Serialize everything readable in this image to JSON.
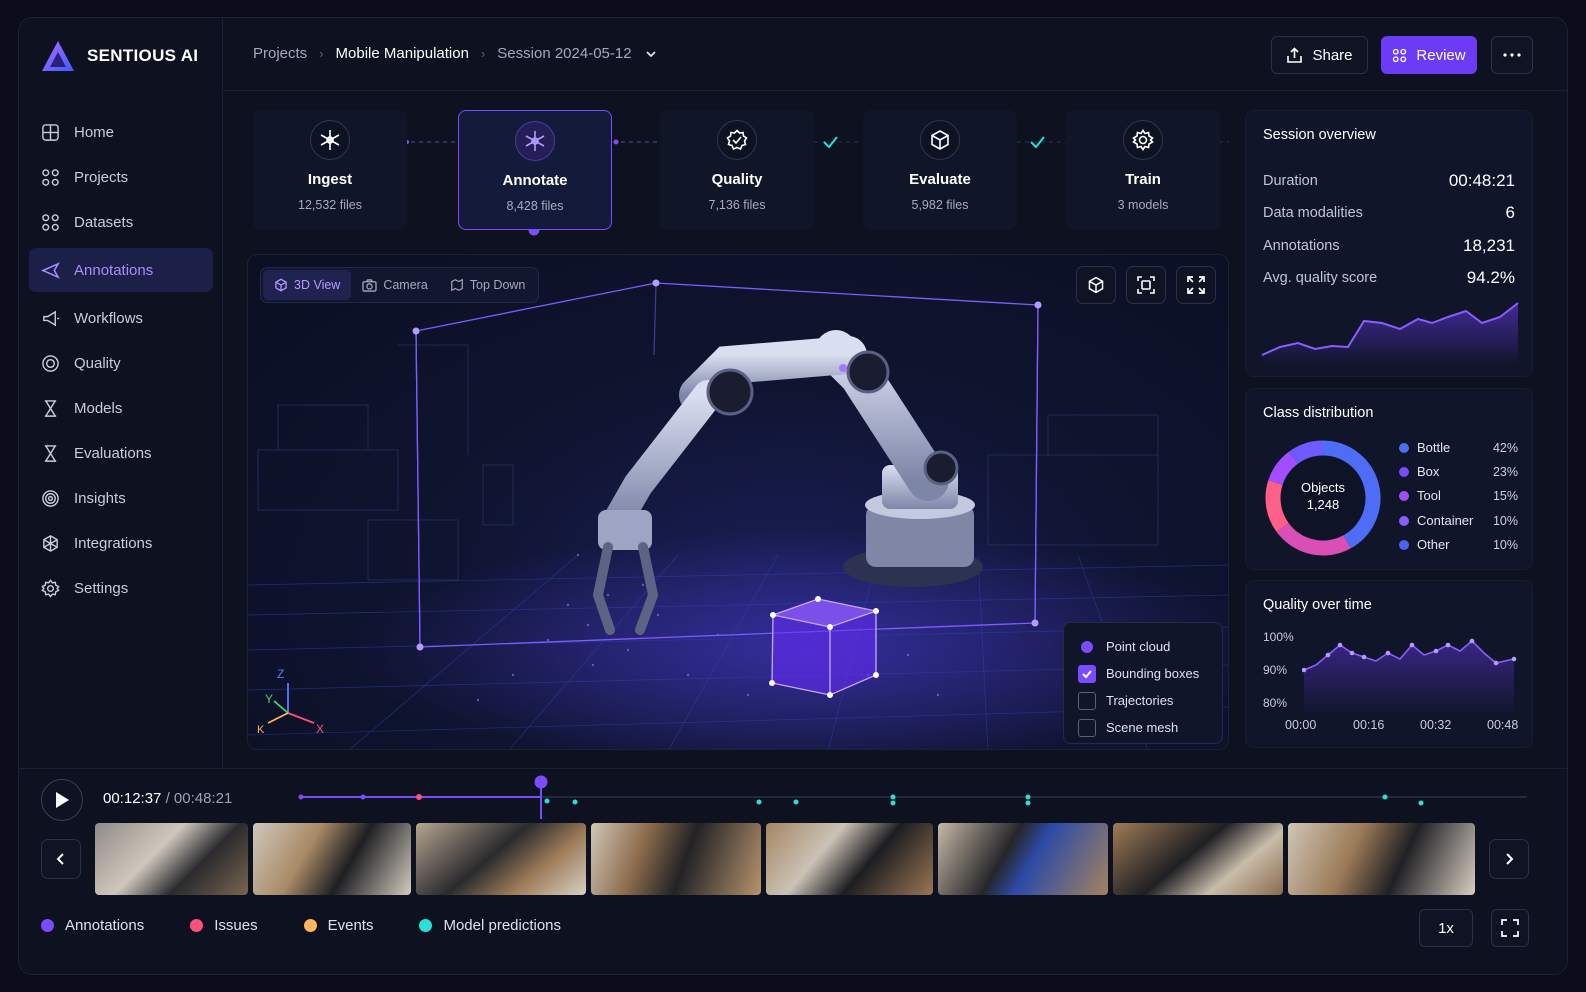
{
  "brand": {
    "name": "SENTIOUS AI"
  },
  "sidebar": {
    "items": [
      {
        "label": "Home",
        "icon": "grid-icon"
      },
      {
        "label": "Projects",
        "icon": "nodes-icon"
      },
      {
        "label": "Datasets",
        "icon": "nodes-icon"
      },
      {
        "label": "Annotations",
        "icon": "annotate-icon",
        "active": true
      },
      {
        "label": "Workflows",
        "icon": "megaphone-icon"
      },
      {
        "label": "Quality",
        "icon": "target-icon"
      },
      {
        "label": "Models",
        "icon": "hourglass-icon"
      },
      {
        "label": "Evaluations",
        "icon": "hourglass-icon"
      },
      {
        "label": "Insights",
        "icon": "target-icon"
      },
      {
        "label": "Integrations",
        "icon": "puzzle-icon"
      },
      {
        "label": "Settings",
        "icon": "gear-icon"
      }
    ]
  },
  "breadcrumb": {
    "projects": "Projects",
    "project": "Mobile Manipulation",
    "session": "Session 2024-05-12"
  },
  "toolbar": {
    "share": "Share",
    "review": "Review"
  },
  "pipeline": [
    {
      "name": "Ingest",
      "sub": "12,532 files"
    },
    {
      "name": "Annotate",
      "sub": "8,428 files"
    },
    {
      "name": "Quality",
      "sub": "7,136 files"
    },
    {
      "name": "Evaluate",
      "sub": "5,982 files"
    },
    {
      "name": "Train",
      "sub": "3 models"
    }
  ],
  "viewport": {
    "tabs": [
      "3D View",
      "Camera",
      "Top Down"
    ],
    "axes": {
      "z": "Z",
      "y": "Y",
      "x": "X",
      "k": "K"
    },
    "layers": [
      {
        "label": "Point cloud",
        "state": "dot"
      },
      {
        "label": "Bounding boxes",
        "state": "checked"
      },
      {
        "label": "Trajectories",
        "state": "unchecked"
      },
      {
        "label": "Scene mesh",
        "state": "unchecked"
      }
    ]
  },
  "overview": {
    "title": "Session overview",
    "rows": [
      {
        "k": "Duration",
        "v": "00:48:21"
      },
      {
        "k": "Data modalities",
        "v": "6"
      },
      {
        "k": "Annotations",
        "v": "18,231"
      },
      {
        "k": "Avg. quality score",
        "v": "94.2%"
      }
    ]
  },
  "class_distribution": {
    "title": "Class distribution",
    "center_label": "Objects",
    "center_value": "1,248",
    "items": [
      {
        "label": "Bottle",
        "pct": "42%",
        "value": 42,
        "color": "#4f6cf7"
      },
      {
        "label": "Box",
        "pct": "23%",
        "value": 23,
        "color": "#7a4cff"
      },
      {
        "label": "Tool",
        "pct": "15%",
        "value": 15,
        "color": "#a24dff"
      },
      {
        "label": "Container",
        "pct": "10%",
        "value": 10,
        "color": "#8a5cff"
      },
      {
        "label": "Other",
        "pct": "10%",
        "value": 10,
        "color": "#4a64f0"
      }
    ]
  },
  "quality_over_time": {
    "title": "Quality over time",
    "yticks": [
      "100%",
      "90%",
      "80%"
    ],
    "xticks": [
      "00:00",
      "00:16",
      "00:32",
      "00:48"
    ]
  },
  "timeline": {
    "current": "00:12:37",
    "total": "/ 00:48:21",
    "progress": 0.26,
    "speed": "1x",
    "legend": [
      {
        "label": "Annotations",
        "color": "#7a4cff"
      },
      {
        "label": "Issues",
        "color": "#ff4f7b"
      },
      {
        "label": "Events",
        "color": "#ffb45e"
      },
      {
        "label": "Model predictions",
        "color": "#27e0d8"
      }
    ]
  }
}
